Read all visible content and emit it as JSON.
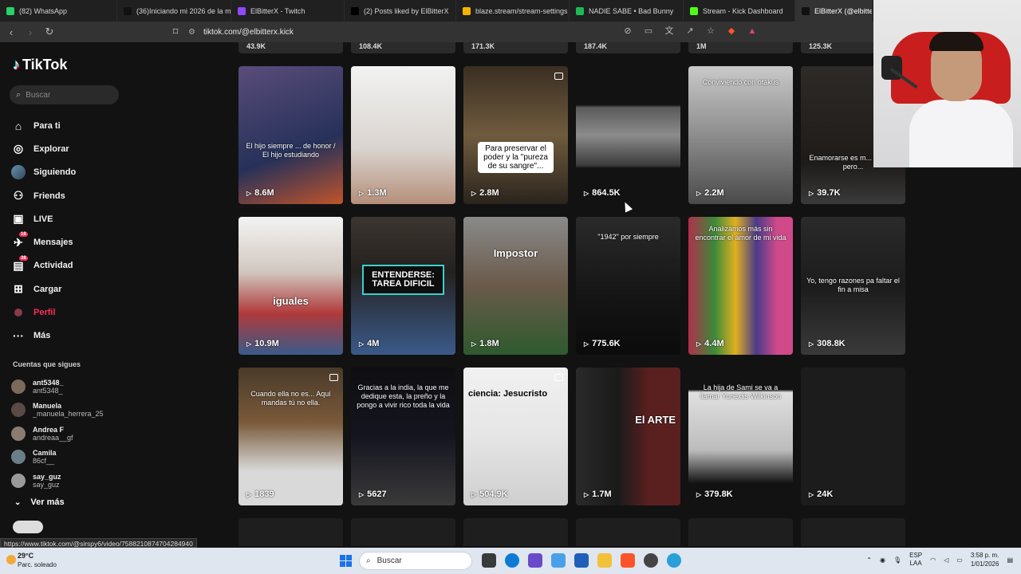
{
  "browser": {
    "tabs": [
      {
        "title": "(82) WhatsApp",
        "color": "#25d366"
      },
      {
        "title": "(36)Iniciando mi 2026 de la m...",
        "color": "#111111"
      },
      {
        "title": "ElBitterX - Twitch",
        "color": "#9146ff"
      },
      {
        "title": "(2) Posts liked by ElBitterX",
        "color": "#000000"
      },
      {
        "title": "blaze.stream/stream-settings",
        "color": "#f4b400"
      },
      {
        "title": "NADIE SABE • Bad Bunny",
        "color": "#1db954"
      },
      {
        "title": "Stream - Kick Dashboard",
        "color": "#53fc18"
      },
      {
        "title": "ElBitterX (@elbitterx",
        "color": "#111111"
      }
    ],
    "url": "tiktok.com/@elbitterx.kick",
    "status_url": "https://www.tiktok.com/@sirspy6/video/7588210874704284940"
  },
  "sidebar": {
    "logo_text": "TikTok",
    "search_placeholder": "Buscar",
    "nav": [
      {
        "label": "Para ti",
        "icon": "home-icon"
      },
      {
        "label": "Explorar",
        "icon": "compass-icon"
      },
      {
        "label": "Siguiendo",
        "icon": "avatar-icon"
      },
      {
        "label": "Friends",
        "icon": "friends-icon"
      },
      {
        "label": "LIVE",
        "icon": "live-icon"
      },
      {
        "label": "Mensajes",
        "icon": "messages-icon",
        "badge": "18"
      },
      {
        "label": "Actividad",
        "icon": "activity-icon",
        "badge": "38"
      },
      {
        "label": "Cargar",
        "icon": "upload-icon"
      },
      {
        "label": "Perfil",
        "icon": "profile-icon"
      },
      {
        "label": "Más",
        "icon": "more-icon"
      }
    ],
    "following_title": "Cuentas que sigues",
    "following": [
      {
        "name": "ant5348_",
        "user": "ant5348_",
        "color": "#7a6a5a"
      },
      {
        "name": "Manuela",
        "user": "_manuela_herrera_25",
        "color": "#5a4a45"
      },
      {
        "name": "Andrea F",
        "user": "andreaa__gf",
        "color": "#8b7b70"
      },
      {
        "name": "Camila",
        "user": "86cf__",
        "color": "#6a7e8a"
      },
      {
        "name": "say_guz",
        "user": "say_guz",
        "color": "#9a9a9a"
      }
    ],
    "ver_mas": "Ver más"
  },
  "top_partial_views": [
    "43.9K",
    "108.4K",
    "171.3K",
    "187.4K",
    "1M",
    "125.3K"
  ],
  "videos": [
    {
      "views": "8.6M",
      "caption": "El hijo siempre ... de honor / El hijo estudiando",
      "bg": "linear-gradient(160deg,#5a4c7a,#26315a 60%,#c0542a)"
    },
    {
      "views": "1.3M",
      "caption": "",
      "bg": "linear-gradient(180deg,#f2f2f2,#d9d4cf 60%,#b58f7a)"
    },
    {
      "views": "2.8M",
      "caption": "Para preservar el poder y la \"pureza de su sangre\"...",
      "bg": "linear-gradient(180deg,#3a2e22,#6f5b3e 50%,#2b241c)",
      "multi": true
    },
    {
      "views": "864.5K",
      "caption": "",
      "bg": "linear-gradient(180deg,#121212 0%,#121212 28%,#5a5a5a 30%,#8c8c8c 50%,#3b3b3b 72%,#121212 74%)"
    },
    {
      "views": "2.2M",
      "caption": "Conviviendo con otakus",
      "bg": "linear-gradient(180deg,#c9c9c9,#8d8d8d 50%,#4a4a4a)"
    },
    {
      "views": "39.7K",
      "caption": "Enamorarse es m... chimba pero...",
      "bg": "linear-gradient(180deg,#2e2a28,#1e1b19 70%,#3a3a3a)"
    },
    {
      "views": "10.9M",
      "caption": "iguales",
      "bg": "linear-gradient(180deg,#f3f3f3,#d1c7c0 40%,#b03a3a 70%,#3a5a8a)"
    },
    {
      "views": "4M",
      "caption": "ENTENDERSE: TAREA DIFICIL",
      "bg": "linear-gradient(180deg,#3c3530,#25211e 40%,#3a5a8a)"
    },
    {
      "views": "1.8M",
      "caption": "Impostor",
      "bg": "linear-gradient(180deg,#8a8a8a,#6a5a4a 50%,#2e5a2e)"
    },
    {
      "views": "775.6K",
      "caption": "\"1942\" por siempre",
      "bg": "linear-gradient(180deg,#2a2a2a,#141414 60%,#0b0b0b)"
    },
    {
      "views": "4.4M",
      "caption": "Analizamos más sin encontrar el amor de mi vida",
      "bg": "linear-gradient(90deg,#b0304a,#3a8a3a 25%,#e0b020 45%,#4a3a8a 65%,#d04a8a 85%)"
    },
    {
      "views": "308.8K",
      "caption": "Yo, tengo razones pa faltar el fin a misa",
      "bg": "linear-gradient(180deg,#2a2a2a,#1c1c1c 50%,#3a3a3a)"
    },
    {
      "views": "1839",
      "caption": "Cuando ella no es... Aquí mandas tú no ella.",
      "bg": "linear-gradient(180deg,#4a3a2a,#7a5a3a 40%,#d9d9d9 75%)",
      "multi": true
    },
    {
      "views": "5627",
      "caption": "Gracias a la india, la que me dedique esta, la preño y la pongo a vivir rico toda la vida",
      "bg": "linear-gradient(180deg,#0e0e12,#151520 50%,#3a3a3a)"
    },
    {
      "views": "504.9K",
      "caption": "ciencia: Jesucristo",
      "bg": "linear-gradient(180deg,#f1f1f1,#e5e5e5 50%,#cfcfcf)",
      "multi": true
    },
    {
      "views": "1.7M",
      "caption": "El ARTE",
      "bg": "linear-gradient(90deg,#2a2a2a,#1a1a1a 40%,#5a2020 70%)"
    },
    {
      "views": "379.8K",
      "caption": "La hija de Sami se va a llamar Yunexiis Wilkinson",
      "bg": "linear-gradient(180deg,#121212 0%,#121212 16%,#e0e0e0 18%,#bcbcbc 60%,#121212 84%)"
    },
    {
      "views": "24K",
      "caption": "",
      "bg": "#1c1c1c"
    }
  ],
  "taskbar": {
    "temp": "29°C",
    "weather": "Parc. soleado",
    "search": "Buscar",
    "lang_top": "ESP",
    "lang_bottom": "LAA",
    "time": "3:58 p. m.",
    "date": "1/01/2026"
  }
}
